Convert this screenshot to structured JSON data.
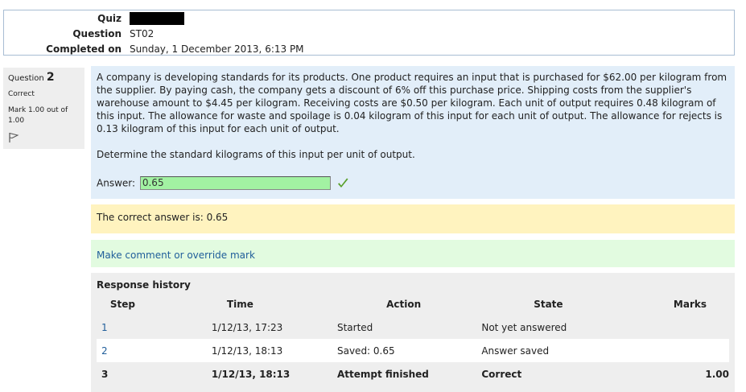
{
  "summary": {
    "rows": [
      {
        "label": "Quiz",
        "value": ""
      },
      {
        "label": "Question",
        "value": "ST02"
      },
      {
        "label": "Completed on",
        "value": "Sunday, 1 December 2013, 6:13 PM"
      }
    ]
  },
  "info": {
    "question_label": "Question",
    "question_number": "2",
    "state": "Correct",
    "grade": "Mark 1.00 out of 1.00"
  },
  "question": {
    "text": "A company is developing standards for its products. One product requires an input that is purchased for $62.00 per kilogram from the supplier. By paying cash, the company gets a discount of 6% off this purchase price. Shipping costs from the supplier's warehouse amount to $4.45 per kilogram. Receiving costs are $0.50 per kilogram. Each unit of output requires 0.48 kilogram of this input. The allowance for waste and spoilage is 0.04 kilogram of this input for each unit of output. The allowance for rejects is 0.13 kilogram of this input for each unit of output.",
    "prompt": "Determine the standard kilograms of this input per unit of output.",
    "answer_label": "Answer:",
    "answer_value": "0.65"
  },
  "outcome": {
    "right_answer": "The correct answer is: 0.65"
  },
  "comment": {
    "link_label": "Make comment or override mark"
  },
  "history": {
    "title": "Response history",
    "headers": [
      "Step",
      "Time",
      "Action",
      "State",
      "Marks"
    ],
    "rows": [
      {
        "step": "1",
        "time": "1/12/13, 17:23",
        "action": "Started",
        "state": "Not yet answered",
        "marks": ""
      },
      {
        "step": "2",
        "time": "1/12/13, 18:13",
        "action": "Saved: 0.65",
        "state": "Answer saved",
        "marks": ""
      },
      {
        "step": "3",
        "time": "1/12/13, 18:13",
        "action": "Attempt finished",
        "state": "Correct",
        "marks": "1.00"
      }
    ]
  },
  "colors": {
    "formulation_bg": "#e2eef9",
    "outcome_bg": "#fff3bf",
    "comment_bg": "#e2fbe0",
    "answer_correct_bg": "#a2f2a2",
    "link": "#1f5d9a",
    "tick": "#5aa02c"
  },
  "icons": {
    "flag": "flag-icon",
    "correct": "check-mark-icon"
  }
}
